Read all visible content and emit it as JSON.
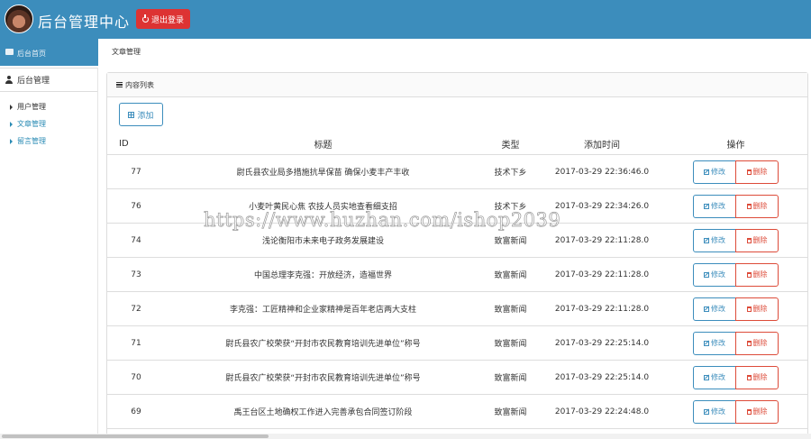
{
  "header": {
    "site_title": "后台管理中心",
    "logout_label": "退出登录",
    "accent_color": "#3c8dbc",
    "logout_color": "#dd3333"
  },
  "sidebar_strip": {
    "label": "后台首页"
  },
  "breadcrumb": "文章管理",
  "sidebar": {
    "section_label": "后台管理",
    "items": [
      {
        "label": "用户管理",
        "active": false
      },
      {
        "label": "文章管理",
        "active": true
      },
      {
        "label": "留言管理",
        "active": true
      }
    ]
  },
  "panel": {
    "title": "内容列表",
    "add_label": "添加"
  },
  "table": {
    "headers": {
      "id": "ID",
      "title": "标题",
      "type": "类型",
      "time": "添加时间",
      "ops": "操作"
    },
    "edit_label": "修改",
    "delete_label": "删除",
    "rows": [
      {
        "id": "77",
        "title": "尉氏县农业局多措施抗旱保苗 确保小麦丰产丰收",
        "type": "技术下乡",
        "time": "2017-03-29 22:36:46.0"
      },
      {
        "id": "76",
        "title": "小麦叶黄民心焦 农技人员实地查看细支招",
        "type": "技术下乡",
        "time": "2017-03-29 22:34:26.0"
      },
      {
        "id": "74",
        "title": "浅论衡阳市未来电子政务发展建设",
        "type": "致富新闻",
        "time": "2017-03-29 22:11:28.0"
      },
      {
        "id": "73",
        "title": "中国总理李克强：开放经济，造福世界",
        "type": "致富新闻",
        "time": "2017-03-29 22:11:28.0"
      },
      {
        "id": "72",
        "title": "李克强：工匠精神和企业家精神是百年老店两大支柱",
        "type": "致富新闻",
        "time": "2017-03-29 22:11:28.0"
      },
      {
        "id": "71",
        "title": "尉氏县农广校荣获“开封市农民教育培训先进单位”称号",
        "type": "致富新闻",
        "time": "2017-03-29 22:25:14.0"
      },
      {
        "id": "70",
        "title": "尉氏县农广校荣获“开封市农民教育培训先进单位”称号",
        "type": "致富新闻",
        "time": "2017-03-29 22:25:14.0"
      },
      {
        "id": "69",
        "title": "禹王台区土地确权工作进入完善承包合同签订阶段",
        "type": "致富新闻",
        "time": "2017-03-29 22:24:48.0"
      }
    ]
  },
  "watermark": "https://www.huzhan.com/ishop2039"
}
